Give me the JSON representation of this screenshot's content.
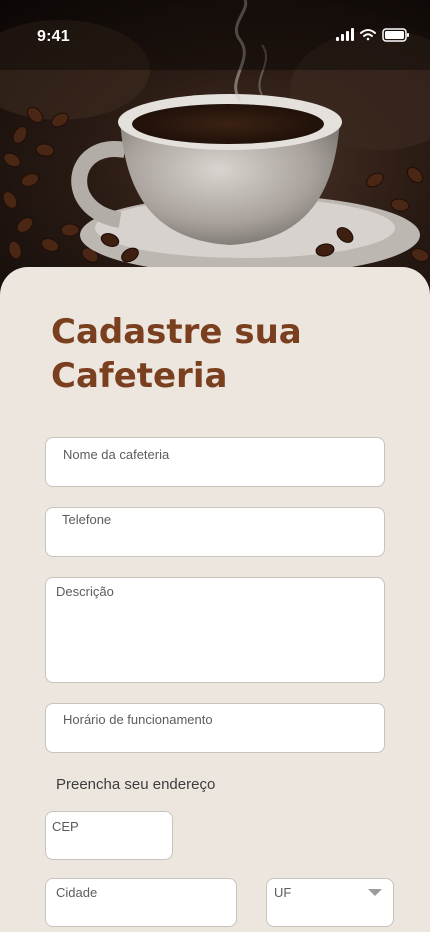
{
  "status_bar": {
    "time": "9:41"
  },
  "hero": {
    "image": "coffee-cup-photo"
  },
  "page": {
    "title_line1": "Cadastre sua",
    "title_line2": "Cafeteria"
  },
  "form": {
    "nome_label": "Nome da cafeteria",
    "telefone_label": "Telefone",
    "descricao_label": "Descrição",
    "horario_label": "Horário de funcionamento",
    "endereco_section": "Preencha seu endereço",
    "cep_label": "CEP",
    "cidade_label": "Cidade",
    "uf_label": "UF"
  },
  "colors": {
    "title": "#7a3f1f",
    "background": "#ece6df",
    "field_border": "#c9c3bd"
  }
}
